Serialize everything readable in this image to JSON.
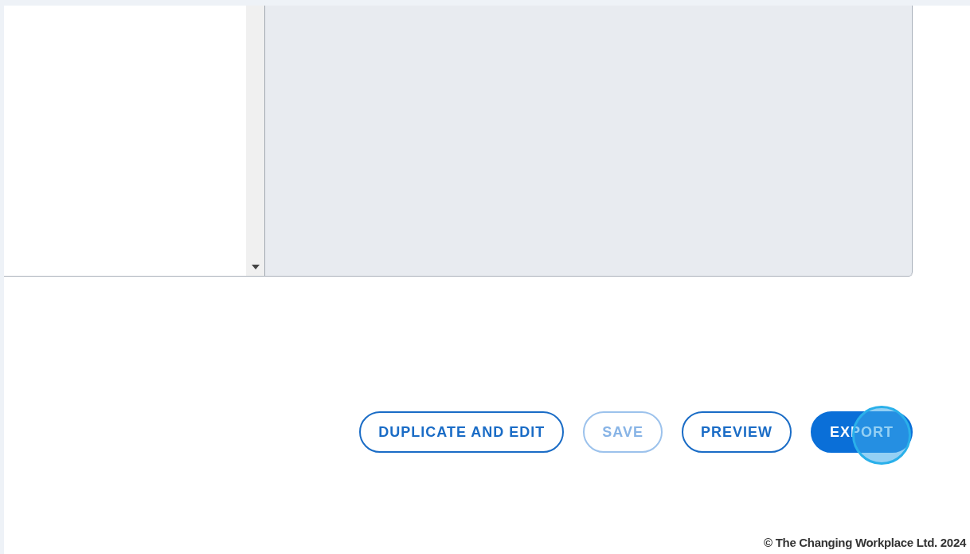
{
  "buttons": [
    {
      "label": "DUPLICATE AND EDIT",
      "kind": "outline",
      "disabled": false
    },
    {
      "label": "SAVE",
      "kind": "outline",
      "disabled": true
    },
    {
      "label": "PREVIEW",
      "kind": "outline",
      "disabled": false
    },
    {
      "label": "EXPORT",
      "kind": "filled",
      "disabled": false,
      "clicked": true
    }
  ],
  "footer": {
    "copyright": "© The Changing Workplace Ltd. 2024"
  }
}
